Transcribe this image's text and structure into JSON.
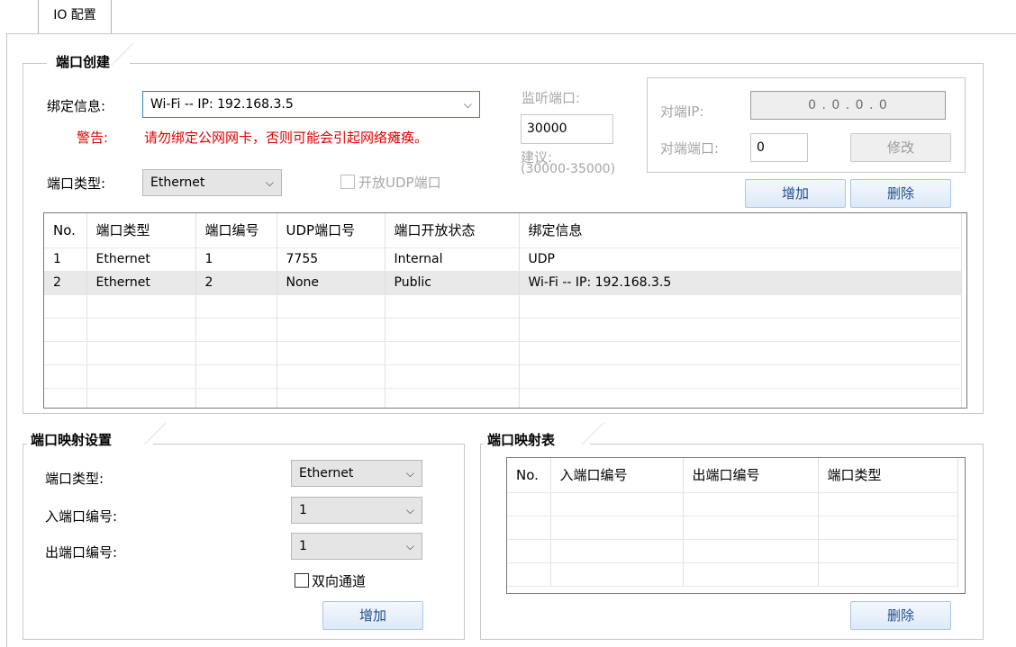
{
  "window": {
    "tab_label": "IO 配置"
  },
  "port_create": {
    "title": "端口创建",
    "bind_label": "绑定信息:",
    "bind_value": "Wi-Fi -- IP: 192.168.3.5",
    "warning_label": "警告:",
    "warning_text": "请勿绑定公网网卡，否则可能会引起网络瘫痪。",
    "listen_port_label": "监听端口:",
    "listen_port_value": "30000",
    "suggest_label": "建议:",
    "suggest_range": "(30000-35000)",
    "remote_ip_label": "对端IP:",
    "remote_ip_value": "0  .  0  .  0  .  0",
    "remote_port_label": "对端端口:",
    "remote_port_value": "0",
    "modify_button": "修改",
    "port_type_label": "端口类型:",
    "port_type_value": "Ethernet",
    "open_udp_label": "开放UDP端口",
    "add_button": "增加",
    "delete_button": "删除",
    "table": {
      "columns": [
        "No.",
        "端口类型",
        "端口编号",
        "UDP端口号",
        "端口开放状态",
        "绑定信息"
      ],
      "rows": [
        [
          "1",
          "Ethernet",
          "1",
          "7755",
          "Internal",
          "UDP"
        ],
        [
          "2",
          "Ethernet",
          "2",
          "None",
          "Public",
          "Wi-Fi -- IP: 192.168.3.5"
        ]
      ]
    }
  },
  "port_map_settings": {
    "title": "端口映射设置",
    "port_type_label": "端口类型:",
    "port_type_value": "Ethernet",
    "in_port_label": "入端口编号:",
    "in_port_value": "1",
    "out_port_label": "出端口编号:",
    "out_port_value": "1",
    "bidirectional_label": "双向通道",
    "add_button": "增加"
  },
  "port_map_table": {
    "title": "端口映射表",
    "columns": [
      "No.",
      "入端口编号",
      "出端口编号",
      "端口类型"
    ],
    "delete_button": "删除"
  }
}
